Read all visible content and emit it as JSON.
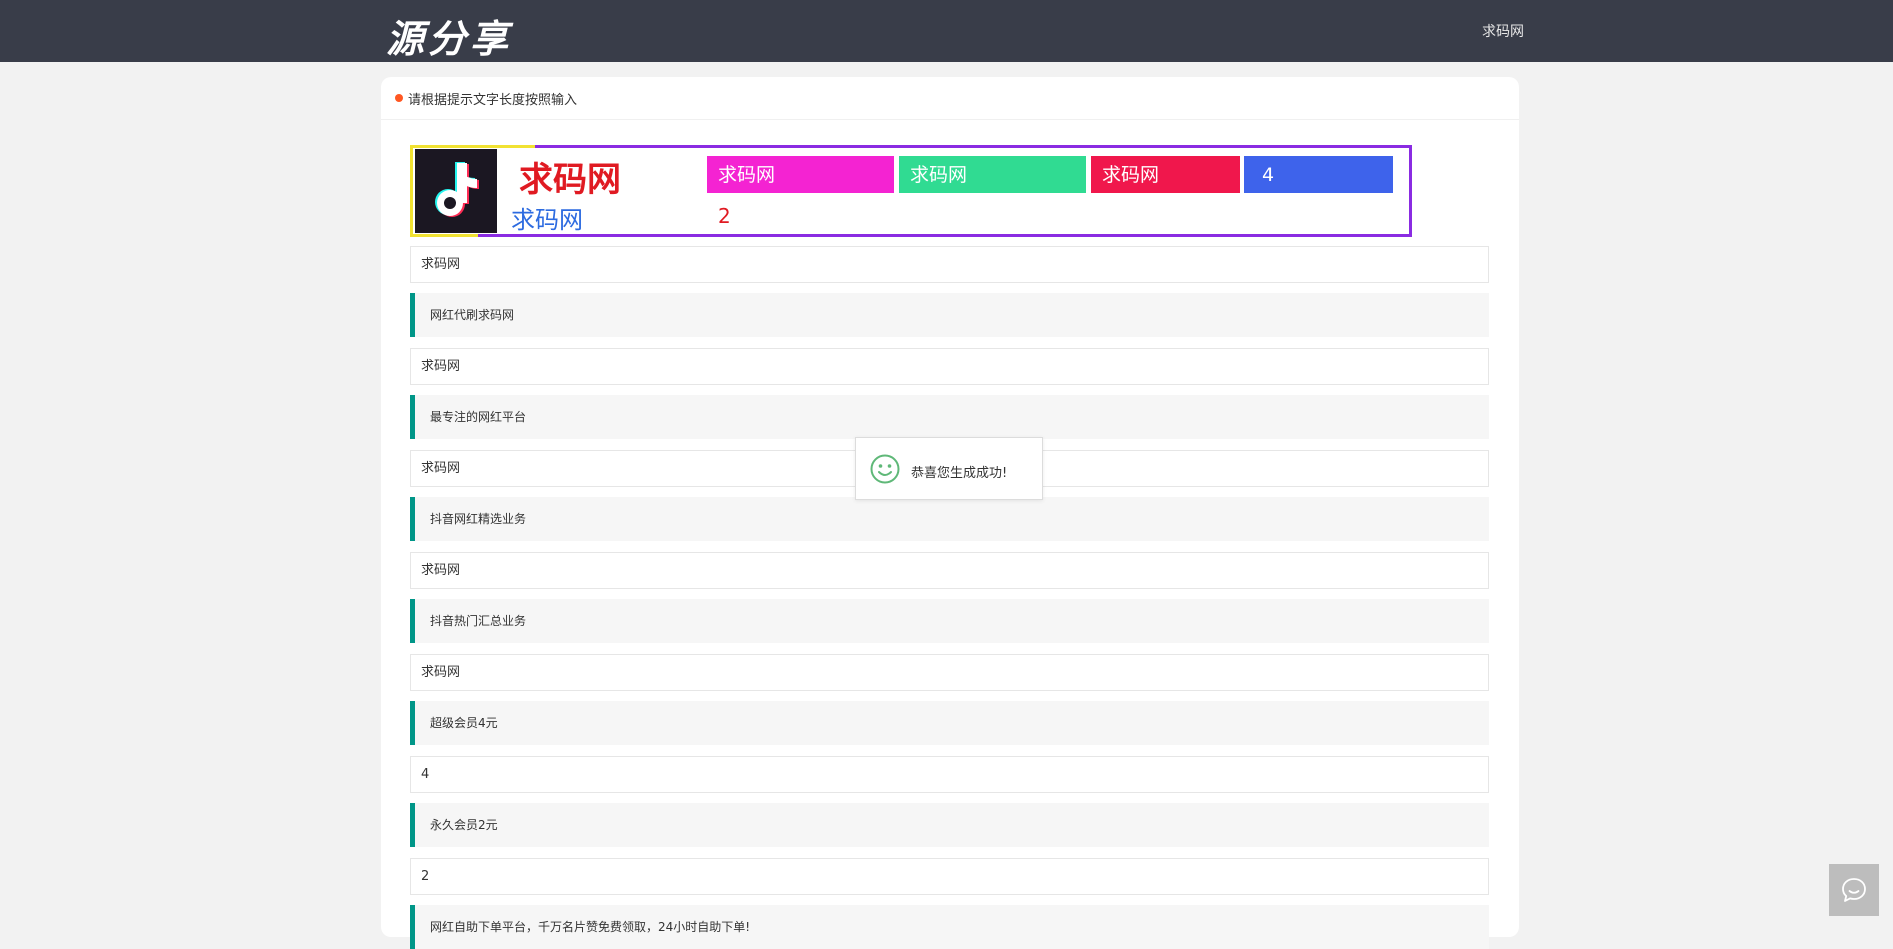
{
  "header": {
    "logo_text": "源分享",
    "nav_link": "求码网"
  },
  "card": {
    "title": "请根据提示文字长度按照输入"
  },
  "banner": {
    "logo_icon": "tiktok-icon",
    "title": "求码网",
    "subtitle": "求码网",
    "number": "2",
    "boxes": [
      {
        "label": "求码网",
        "color": "#f423d2"
      },
      {
        "label": "求码网",
        "color": "#30db92"
      },
      {
        "label": "求码网",
        "color": "#f0174c"
      },
      {
        "label": "4",
        "color": "#3e63eb"
      }
    ]
  },
  "form": {
    "inputs": [
      "求码网",
      "求码网",
      "求码网",
      "求码网",
      "求码网",
      "4",
      "2"
    ],
    "hints": [
      "网红代刷求码网",
      "最专注的网红平台",
      "抖音网红精选业务",
      "抖音热门汇总业务",
      "超级会员4元",
      "永久会员2元",
      "网红自助下单平台，千万名片赞免费领取，24小时自助下单!"
    ]
  },
  "toast": {
    "icon": "smile-icon",
    "message": "恭喜您生成成功!"
  },
  "colors": {
    "header_bg": "#393d49",
    "accent_green": "#009688",
    "dot": "#ff5722",
    "toast_icon": "#5fb878"
  }
}
